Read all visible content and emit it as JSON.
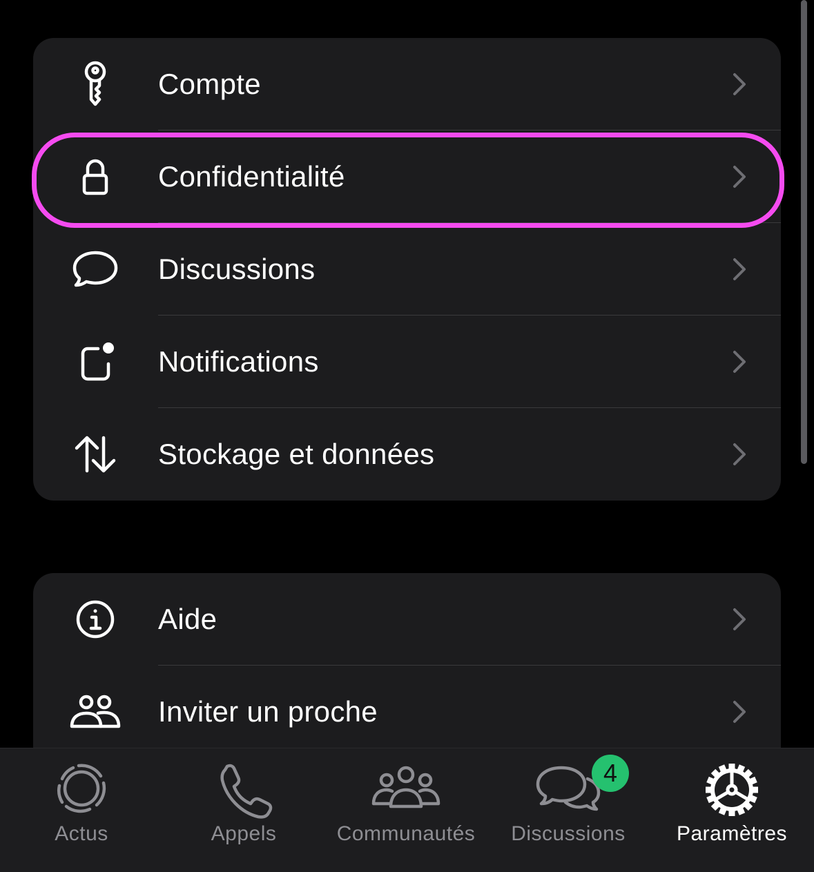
{
  "colors": {
    "background": "#000000",
    "group_background": "#1c1c1e",
    "separator": "#3a3a3c",
    "highlight_outline": "#f54bf0",
    "tab_inactive": "#8e8e93",
    "tab_active": "#ffffff",
    "badge_background": "#25c16f"
  },
  "settings": {
    "group1": [
      {
        "label": "Compte",
        "icon": "key-icon"
      },
      {
        "label": "Confidentialité",
        "icon": "lock-icon",
        "highlighted": true
      },
      {
        "label": "Discussions",
        "icon": "chat-bubble-icon"
      },
      {
        "label": "Notifications",
        "icon": "notification-badge-icon"
      },
      {
        "label": "Stockage et données",
        "icon": "up-down-arrows-icon"
      }
    ],
    "group2": [
      {
        "label": "Aide",
        "icon": "info-circle-icon"
      },
      {
        "label": "Inviter un proche",
        "icon": "people-icon"
      }
    ]
  },
  "tabbar": {
    "tabs": [
      {
        "label": "Actus",
        "icon": "status-ring-icon",
        "active": false
      },
      {
        "label": "Appels",
        "icon": "phone-icon",
        "active": false
      },
      {
        "label": "Communautés",
        "icon": "community-icon",
        "active": false
      },
      {
        "label": "Discussions",
        "icon": "chats-icon",
        "active": false,
        "badge": "4"
      },
      {
        "label": "Paramètres",
        "icon": "gear-icon",
        "active": true
      }
    ]
  }
}
